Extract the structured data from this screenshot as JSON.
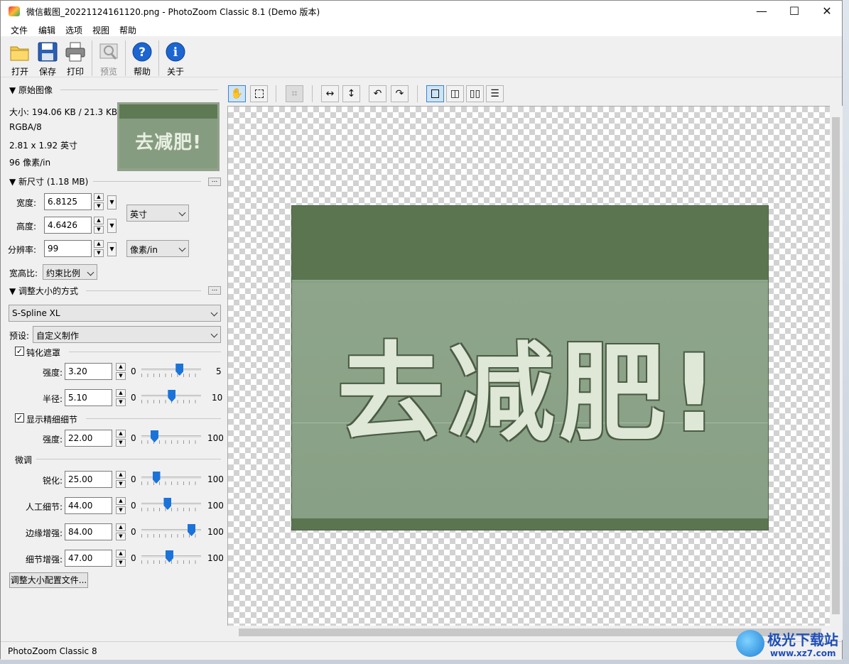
{
  "window": {
    "title": "微信截图_20221124161120.png - PhotoZoom Classic 8.1 (Demo 版本)",
    "minimize": "—",
    "maximize": "☐",
    "close": "✕"
  },
  "menu": [
    "文件",
    "编辑",
    "选项",
    "视图",
    "帮助"
  ],
  "toolbar": {
    "open": "打开",
    "save": "保存",
    "print": "打印",
    "preview": "预览",
    "help": "帮助",
    "about": "关于"
  },
  "original": {
    "header": "▼ 原始图像",
    "size": "大小: 194.06 KB / 21.3 KB",
    "mode": "RGBA/8",
    "dims": "2.81 x 1.92 英寸",
    "res": "96 像素/in",
    "thumb_text": "去减肥!"
  },
  "new_size": {
    "header": "▼ 新尺寸 (1.18 MB)",
    "dots": "...",
    "width_label": "宽度:",
    "width_value": "6.8125",
    "height_label": "高度:",
    "height_value": "4.6426",
    "res_label": "分辨率:",
    "res_value": "99",
    "unit": "英寸",
    "res_unit": "像素/in",
    "aspect_label": "宽高比:",
    "aspect_value": "约束比例"
  },
  "resize_method": {
    "header": "▼ 调整大小的方式",
    "dots": "...",
    "method": "S-Spline XL",
    "preset_label": "预设:",
    "preset_value": "自定义制作"
  },
  "unsharp": {
    "label": "钝化遮罩",
    "checked": "✓",
    "strength_label": "强度:",
    "strength_value": "3.20",
    "strength_min": "0",
    "strength_max": "5",
    "strength_level": 0.64,
    "radius_label": "半径:",
    "radius_value": "5.10",
    "radius_min": "0",
    "radius_max": "10",
    "radius_level": 0.51
  },
  "detail": {
    "label": "显示精细细节",
    "checked": "✓",
    "strength_label": "强度:",
    "strength_value": "22.00",
    "min": "0",
    "max": "100",
    "level": 0.22
  },
  "finetune": {
    "header": "微调",
    "rows": [
      {
        "label": "锐化:",
        "value": "25.00",
        "min": "0",
        "max": "100",
        "level": 0.25
      },
      {
        "label": "人工细节:",
        "value": "44.00",
        "min": "0",
        "max": "100",
        "level": 0.44
      },
      {
        "label": "边缘增强:",
        "value": "84.00",
        "min": "0",
        "max": "100",
        "level": 0.84
      },
      {
        "label": "细节增强:",
        "value": "47.00",
        "min": "0",
        "max": "100",
        "level": 0.47
      }
    ],
    "profiles_button": "调整大小配置文件..."
  },
  "preview_image_text": "去减肥!",
  "status": "PhotoZoom Classic 8",
  "watermark": {
    "name": "极光下载站",
    "url": "www.xz7.com"
  }
}
